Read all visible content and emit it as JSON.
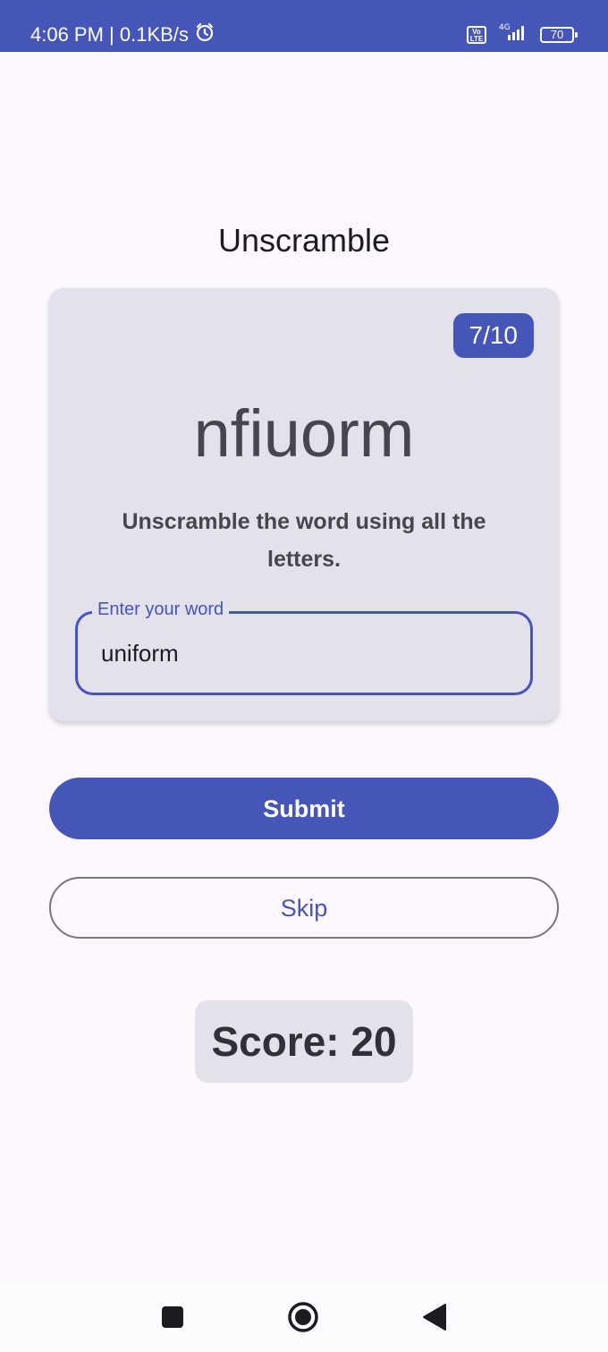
{
  "status_bar": {
    "time": "4:06 PM | 0.1KB/s",
    "network": "4G",
    "volte": "Vo LTE",
    "battery": "70"
  },
  "title": "Unscramble",
  "card": {
    "counter": "7/10",
    "scrambled_word": "nfiuorm",
    "instructions": "Unscramble the word using all the letters.",
    "input_label": "Enter your word",
    "input_value": "uniform"
  },
  "buttons": {
    "submit": "Submit",
    "skip": "Skip"
  },
  "score": "Score: 20",
  "colors": {
    "primary": "#4555b8",
    "card_bg": "#e3e1ec",
    "page_bg": "#fcf8fd"
  }
}
